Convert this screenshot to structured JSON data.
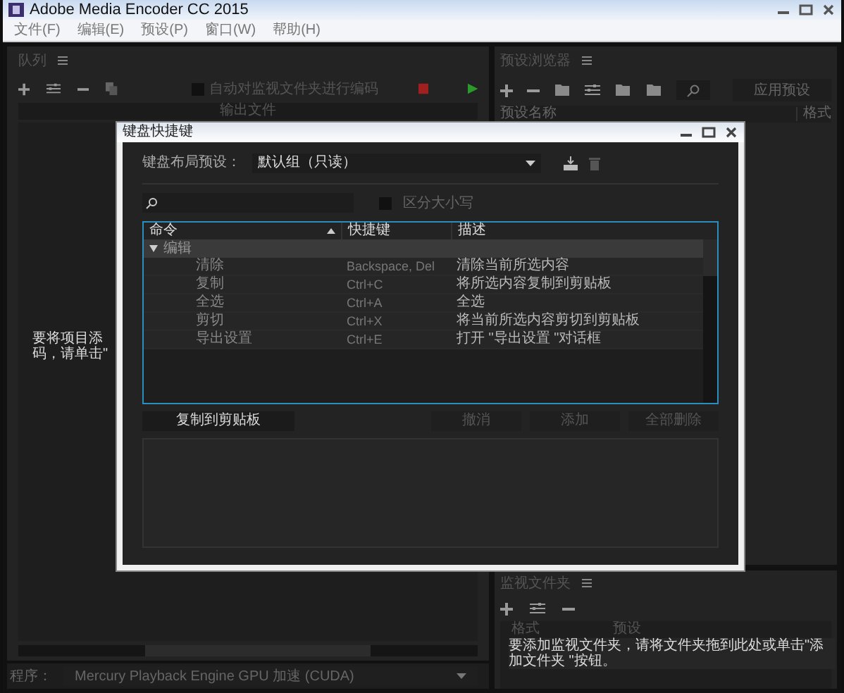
{
  "window": {
    "title": "Adobe Media Encoder CC 2015"
  },
  "menu": [
    "文件(F)",
    "编辑(E)",
    "预设(P)",
    "窗口(W)",
    "帮助(H)"
  ],
  "queue": {
    "title": "队列",
    "auto_encode": {
      "label": "自动对监视文件夹进行编码",
      "checked": false
    },
    "column": "输出文件",
    "hint_lines": [
      "要将项目添",
      "码，请单击\""
    ]
  },
  "renderer": {
    "label": "程序：",
    "value": "Mercury Playback Engine GPU 加速 (CUDA)"
  },
  "preset_browser": {
    "title": "预设浏览器",
    "apply_button": "应用预设",
    "columns": [
      "预设名称",
      "格式"
    ]
  },
  "watch_folders": {
    "title": "监视文件夹",
    "columns": [
      "格式",
      "预设"
    ],
    "hint": "要添加监视文件夹，请将文件夹拖到此处或单击\"添加文件夹 \"按钮。"
  },
  "dialog": {
    "title": "键盘快捷键",
    "layout_label": "键盘布局预设：",
    "layout_value": "默认组（只读）",
    "case_sensitive": {
      "label": "区分大小写",
      "checked": false
    },
    "columns": [
      "命令",
      "快捷键",
      "描述"
    ],
    "groups": [
      {
        "label": "编辑",
        "expanded": true,
        "children": [
          {
            "command": "清除",
            "shortcut": "Backspace, Del",
            "description": "清除当前所选内容"
          },
          {
            "command": "复制",
            "shortcut": "Ctrl+C",
            "description": "将所选内容复制到剪贴板"
          },
          {
            "command": "全选",
            "shortcut": "Ctrl+A",
            "description": "全选"
          },
          {
            "command": "剪切",
            "shortcut": "Ctrl+X",
            "description": "将当前所选内容剪切到剪贴板"
          },
          {
            "command": "导出设置",
            "shortcut": "Ctrl+E",
            "description": "打开 \"导出设置 \"对话框"
          }
        ]
      }
    ],
    "buttons": [
      {
        "label": "复制到剪贴板",
        "disabled": false
      },
      {
        "label": "撤消",
        "disabled": true
      },
      {
        "label": "添加",
        "disabled": true
      },
      {
        "label": "全部删除",
        "disabled": true
      }
    ]
  }
}
